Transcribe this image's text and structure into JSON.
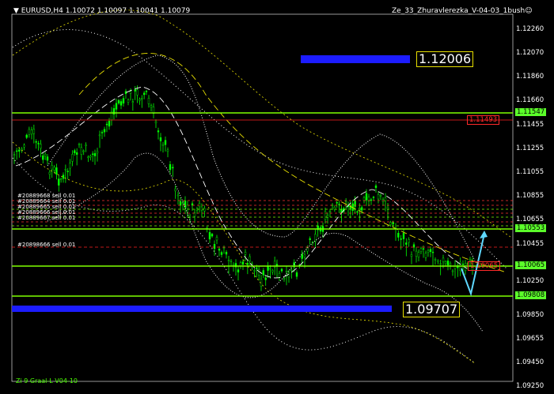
{
  "header": {
    "symbol_line": "EURUSD,H4  1.10072 1.10097 1.10041 1.10079",
    "expert": "Ze_33_Zhuravlerezka_V-04-03_1bush",
    "smiley": "☺"
  },
  "footer": {
    "indicator": "Zi 9 Graal-L V04-10"
  },
  "price_axis": {
    "ticks": [
      "1.12260",
      "1.12070",
      "1.11860",
      "1.11660",
      "1.11455",
      "1.11255",
      "1.11055",
      "1.10855",
      "1.10655",
      "1.10455",
      "1.10250",
      "1.09850",
      "1.09655",
      "1.09450",
      "1.09250"
    ],
    "highlighted": [
      "1.11547",
      "1.10553",
      "1.10065",
      "1.09808"
    ]
  },
  "levels": {
    "upper_target": "1.12006",
    "lower_target": "1.09707",
    "red_tag": "1.11493",
    "red_tag2": "1.10065"
  },
  "orders": [
    "#20889668 sell 0.01",
    "#20889664 sell 0.01",
    "#20889665 sell 0.01",
    "#20889666 sell 0.01",
    "#20889667 sell 0.01",
    "#20898666 sell 0.01"
  ],
  "colors": {
    "candle": "#00ff00",
    "green_level": "#7fff00",
    "red_level": "#ff2020",
    "blue_bar": "#1c1cff",
    "yellow": "#e8e000",
    "cyan_arrow": "#5fd8ff"
  }
}
